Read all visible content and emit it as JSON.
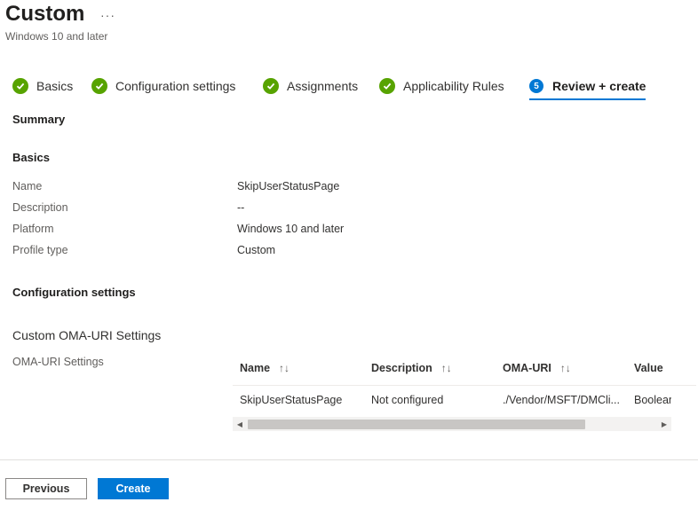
{
  "header": {
    "title": "Custom",
    "more_label": "···",
    "subtitle": "Windows 10 and later"
  },
  "tabs": [
    {
      "label": "Basics",
      "state": "complete"
    },
    {
      "label": "Configuration settings",
      "state": "complete"
    },
    {
      "label": "Assignments",
      "state": "complete"
    },
    {
      "label": "Applicability Rules",
      "state": "complete"
    },
    {
      "label": "Review + create",
      "state": "active",
      "step": "5"
    }
  ],
  "summary": {
    "heading": "Summary",
    "basics_heading": "Basics",
    "fields": [
      {
        "key": "Name",
        "value": "SkipUserStatusPage"
      },
      {
        "key": "Description",
        "value": "--"
      },
      {
        "key": "Platform",
        "value": "Windows 10 and later"
      },
      {
        "key": "Profile type",
        "value": "Custom"
      }
    ],
    "config_heading": "Configuration settings",
    "custom_heading": "Custom OMA-URI Settings",
    "oma_label": "OMA-URI Settings"
  },
  "table": {
    "columns": [
      "Name",
      "Description",
      "OMA-URI",
      "Value"
    ],
    "sort_icon": "↑↓",
    "rows": [
      [
        "SkipUserStatusPage",
        "Not configured",
        "./Vendor/MSFT/DMCli...",
        "Boolean"
      ]
    ]
  },
  "footer": {
    "previous_label": "Previous",
    "create_label": "Create"
  },
  "colors": {
    "accent": "#0078d4",
    "success": "#57a300"
  }
}
